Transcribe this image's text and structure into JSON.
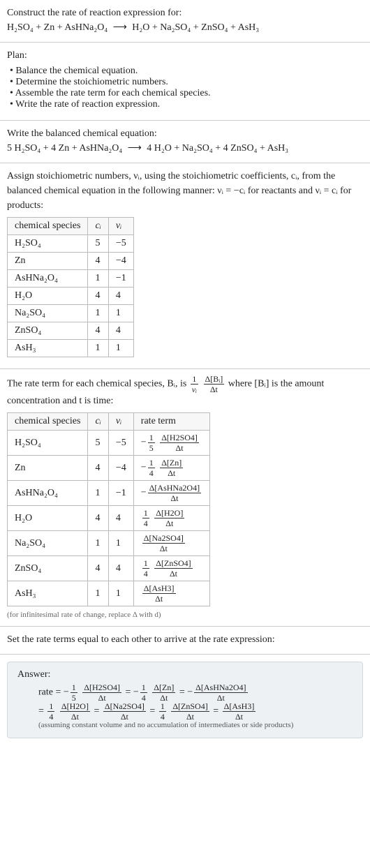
{
  "sec1": {
    "title": "Construct the rate of reaction expression for:",
    "eq_lhs": "H₂SO₄ + Zn + AsHNa₂O₄",
    "arrow": "⟶",
    "eq_rhs": "H₂O + Na₂SO₄ + ZnSO₄ + AsH₃"
  },
  "sec2": {
    "title": "Plan:",
    "items": [
      "Balance the chemical equation.",
      "Determine the stoichiometric numbers.",
      "Assemble the rate term for each chemical species.",
      "Write the rate of reaction expression."
    ]
  },
  "sec3": {
    "title": "Write the balanced chemical equation:",
    "eq_lhs": "5 H₂SO₄ + 4 Zn + AsHNa₂O₄",
    "arrow": "⟶",
    "eq_rhs": "4 H₂O + Na₂SO₄ + 4 ZnSO₄ + AsH₃"
  },
  "sec4": {
    "para": "Assign stoichiometric numbers, νᵢ, using the stoichiometric coefficients, cᵢ, from the balanced chemical equation in the following manner: νᵢ = −cᵢ for reactants and νᵢ = cᵢ for products:",
    "headers": [
      "chemical species",
      "cᵢ",
      "νᵢ"
    ],
    "rows": [
      [
        "H₂SO₄",
        "5",
        "−5"
      ],
      [
        "Zn",
        "4",
        "−4"
      ],
      [
        "AsHNa₂O₄",
        "1",
        "−1"
      ],
      [
        "H₂O",
        "4",
        "4"
      ],
      [
        "Na₂SO₄",
        "1",
        "1"
      ],
      [
        "ZnSO₄",
        "4",
        "4"
      ],
      [
        "AsH₃",
        "1",
        "1"
      ]
    ]
  },
  "sec5": {
    "para_pre": "The rate term for each chemical species, Bᵢ, is ",
    "frac1_num": "1",
    "frac1_den": "νᵢ",
    "frac2_num": "Δ[Bᵢ]",
    "frac2_den": "Δt",
    "para_post": " where [Bᵢ] is the amount concentration and t is time:",
    "headers": [
      "chemical species",
      "cᵢ",
      "νᵢ",
      "rate term"
    ],
    "rows": [
      {
        "sp": "H₂SO₄",
        "c": "5",
        "v": "−5",
        "rt_pre": "−",
        "rt_c_num": "1",
        "rt_c_den": "5",
        "rt_num": "Δ[H2SO4]",
        "rt_den": "Δt"
      },
      {
        "sp": "Zn",
        "c": "4",
        "v": "−4",
        "rt_pre": "−",
        "rt_c_num": "1",
        "rt_c_den": "4",
        "rt_num": "Δ[Zn]",
        "rt_den": "Δt"
      },
      {
        "sp": "AsHNa₂O₄",
        "c": "1",
        "v": "−1",
        "rt_pre": "−",
        "rt_c_num": "",
        "rt_c_den": "",
        "rt_num": "Δ[AsHNa2O4]",
        "rt_den": "Δt"
      },
      {
        "sp": "H₂O",
        "c": "4",
        "v": "4",
        "rt_pre": "",
        "rt_c_num": "1",
        "rt_c_den": "4",
        "rt_num": "Δ[H2O]",
        "rt_den": "Δt"
      },
      {
        "sp": "Na₂SO₄",
        "c": "1",
        "v": "1",
        "rt_pre": "",
        "rt_c_num": "",
        "rt_c_den": "",
        "rt_num": "Δ[Na2SO4]",
        "rt_den": "Δt"
      },
      {
        "sp": "ZnSO₄",
        "c": "4",
        "v": "4",
        "rt_pre": "",
        "rt_c_num": "1",
        "rt_c_den": "4",
        "rt_num": "Δ[ZnSO4]",
        "rt_den": "Δt"
      },
      {
        "sp": "AsH₃",
        "c": "1",
        "v": "1",
        "rt_pre": "",
        "rt_c_num": "",
        "rt_c_den": "",
        "rt_num": "Δ[AsH3]",
        "rt_den": "Δt"
      }
    ],
    "note": "(for infinitesimal rate of change, replace Δ with d)"
  },
  "sec6": {
    "title": "Set the rate terms equal to each other to arrive at the rate expression:"
  },
  "answer": {
    "label": "Answer:",
    "rate_label": "rate = ",
    "terms_line1": [
      {
        "pre": "−",
        "cnum": "1",
        "cden": "5",
        "num": "Δ[H2SO4]",
        "den": "Δt"
      },
      {
        "pre": "= −",
        "cnum": "1",
        "cden": "4",
        "num": "Δ[Zn]",
        "den": "Δt"
      },
      {
        "pre": "= −",
        "cnum": "",
        "cden": "",
        "num": "Δ[AsHNa2O4]",
        "den": "Δt"
      }
    ],
    "terms_line2": [
      {
        "pre": "= ",
        "cnum": "1",
        "cden": "4",
        "num": "Δ[H2O]",
        "den": "Δt"
      },
      {
        "pre": "= ",
        "cnum": "",
        "cden": "",
        "num": "Δ[Na2SO4]",
        "den": "Δt"
      },
      {
        "pre": "= ",
        "cnum": "1",
        "cden": "4",
        "num": "Δ[ZnSO4]",
        "den": "Δt"
      },
      {
        "pre": "= ",
        "cnum": "",
        "cden": "",
        "num": "Δ[AsH3]",
        "den": "Δt"
      }
    ],
    "note": "(assuming constant volume and no accumulation of intermediates or side products)"
  }
}
